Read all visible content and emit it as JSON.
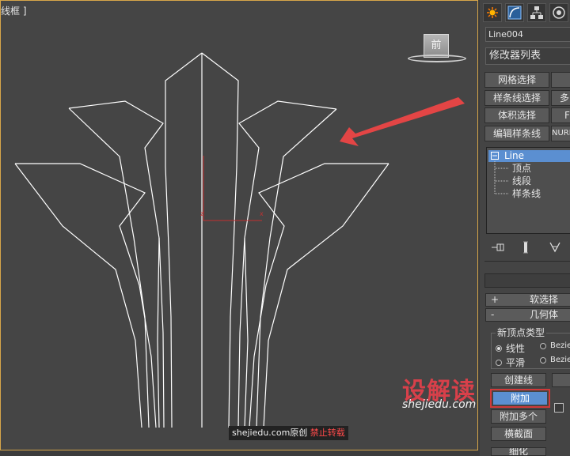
{
  "viewport": {
    "label": "线框 ]",
    "viewcube_label": "前"
  },
  "watermark": {
    "source": "shejiedu.com原创",
    "notice": "禁止转载",
    "logo_cn": "设解读",
    "logo_url": "shejiedu.com"
  },
  "command_panel": {
    "tabs": [
      "create-icon",
      "modify-icon",
      "hierarchy-icon",
      "motion-icon"
    ],
    "object_name": "Line004",
    "modifier_list": "修改器列表",
    "modifier_buttons": {
      "mesh_select": "网格选择",
      "spline_select": "样条线选择",
      "volume_select": "体积选择",
      "edit_spline": "编辑样条线",
      "col2_row2": "多",
      "col2_row3": "F",
      "col2_row4": "NURE"
    },
    "stack": {
      "root": "Line",
      "items": [
        "顶点",
        "线段",
        "样条线"
      ]
    },
    "stack_tools": [
      "pin-stack-icon",
      "show-end-result-icon",
      "make-unique-icon"
    ],
    "rollouts": {
      "soft_selection": "软选择",
      "geometry": "几何体",
      "plus": "+",
      "minus": "-"
    },
    "new_vertex_type": {
      "title": "新顶点类型",
      "options": [
        "线性",
        "平滑",
        "Bezie",
        "Bezie"
      ],
      "selected": "线性"
    },
    "buttons": {
      "create_line": "创建线",
      "attach": "附加",
      "attach_multiple": "附加多个",
      "cross_section": "横截面",
      "bottom_partial": "细化"
    }
  },
  "colors": {
    "viewport_bg": "#454545",
    "active_border": "#d7a64a",
    "highlight": "#5b8fd1",
    "arrow": "#e34545"
  }
}
